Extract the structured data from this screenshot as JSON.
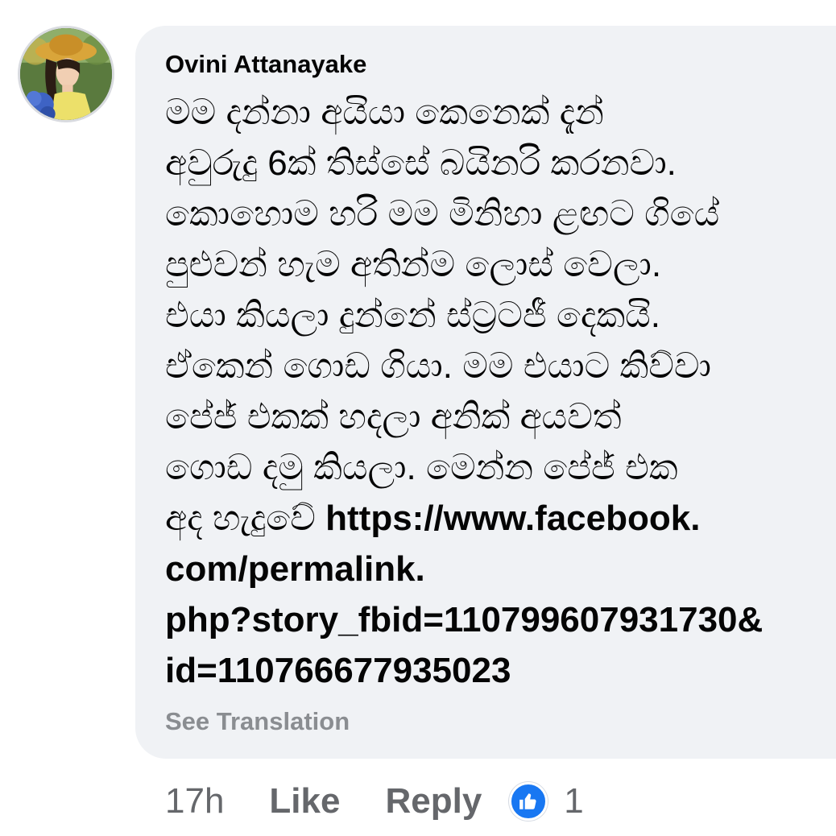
{
  "comment": {
    "author": "Ovini Attanayake",
    "lines": [
      {
        "text": "මම දන්නා අයියා කෙනෙක් දැන්",
        "link": ""
      },
      {
        "text": "අවුරුදු 6ක් තිස්සේ බයිනරි කරනවා.",
        "link": ""
      },
      {
        "text": "කොහොම හරි මම මිනිහා ළඟට ගියේ",
        "link": ""
      },
      {
        "text": "පුළුවන් හැම අතින්ම ලොස් වෙලා.",
        "link": ""
      },
      {
        "text": "එයා කියලා දුන්නේ ස්ට්‍රටජී දෙකයි.",
        "link": ""
      },
      {
        "text": "ඒකෙන් ගොඩ ගියා. මම එයාට කිව්වා",
        "link": ""
      },
      {
        "text": "පේජ් එකක් හදලා අනික් අයවත්",
        "link": ""
      },
      {
        "text": "ගොඩ දමු කියලා. මෙන්න පේජ් එක",
        "link": ""
      },
      {
        "text": "අද හැදුවේ ",
        "link": "https://www.facebook."
      },
      {
        "text": "",
        "link": "com/permalink."
      },
      {
        "text": "",
        "link": "php?story_fbid=110799607931730&"
      },
      {
        "text": "",
        "link": "id=110766677935023"
      }
    ],
    "see_translation": "See Translation"
  },
  "actions": {
    "time": "17h",
    "like_label": "Like",
    "reply_label": "Reply",
    "reaction_icon": "thumbs-up-icon",
    "reaction_count": "1"
  },
  "colors": {
    "bubble": "#f0f2f5",
    "text": "#050505",
    "muted": "#65676b",
    "see_translation": "#8a8d91",
    "reaction": "#1877f2"
  }
}
